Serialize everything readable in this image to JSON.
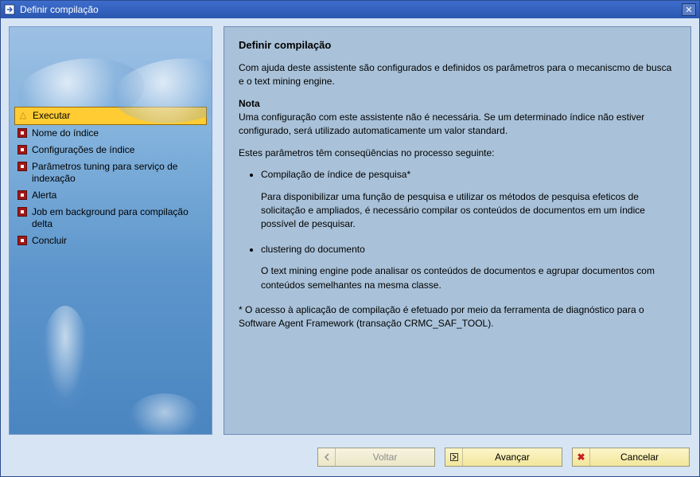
{
  "window": {
    "title": "Definir compilação"
  },
  "sidebar": {
    "steps": [
      {
        "label": "Executar",
        "state": "active"
      },
      {
        "label": "Nome do índice",
        "state": "pending"
      },
      {
        "label": "Configurações de índice",
        "state": "pending"
      },
      {
        "label": "Parâmetros tuning para serviço de indexação",
        "state": "pending"
      },
      {
        "label": "Alerta",
        "state": "pending"
      },
      {
        "label": "Job em background para compilação delta",
        "state": "pending"
      },
      {
        "label": "Concluir",
        "state": "pending"
      }
    ]
  },
  "content": {
    "heading": "Definir compilação",
    "intro": "Com ajuda deste assistente são configurados e definidos os parâmetros para o mecaniscmo de busca e o text mining engine.",
    "note_label": "Nota",
    "note_body": "Uma configuração com este assistente não é necessária. Se um determinado índice não estiver configurado, será utilizado automaticamente um valor standard.",
    "params_lead": "Estes parâmetros têm conseqüências no processo seguinte:",
    "bullet1_title": "Compilação de índice de pesquisa*",
    "bullet1_body": "Para disponibilizar uma função de pesquisa e utilizar os métodos de pesquisa efeticos de solicitação e ampliados, é necessário compilar os conteúdos de documentos em um índice possível de pesquisar.",
    "bullet2_title": "clustering do documento",
    "bullet2_body": "O text mining engine pode analisar os conteúdos de documentos e agrupar documentos com conteúdos semelhantes na mesma classe.",
    "footnote": "* O acesso à aplicação de compilação é efetuado por meio da ferramenta de diagnóstico para o Software Agent Framework (transação CRMC_SAF_TOOL)."
  },
  "footer": {
    "back": "Voltar",
    "next": "Avançar",
    "cancel": "Cancelar"
  }
}
